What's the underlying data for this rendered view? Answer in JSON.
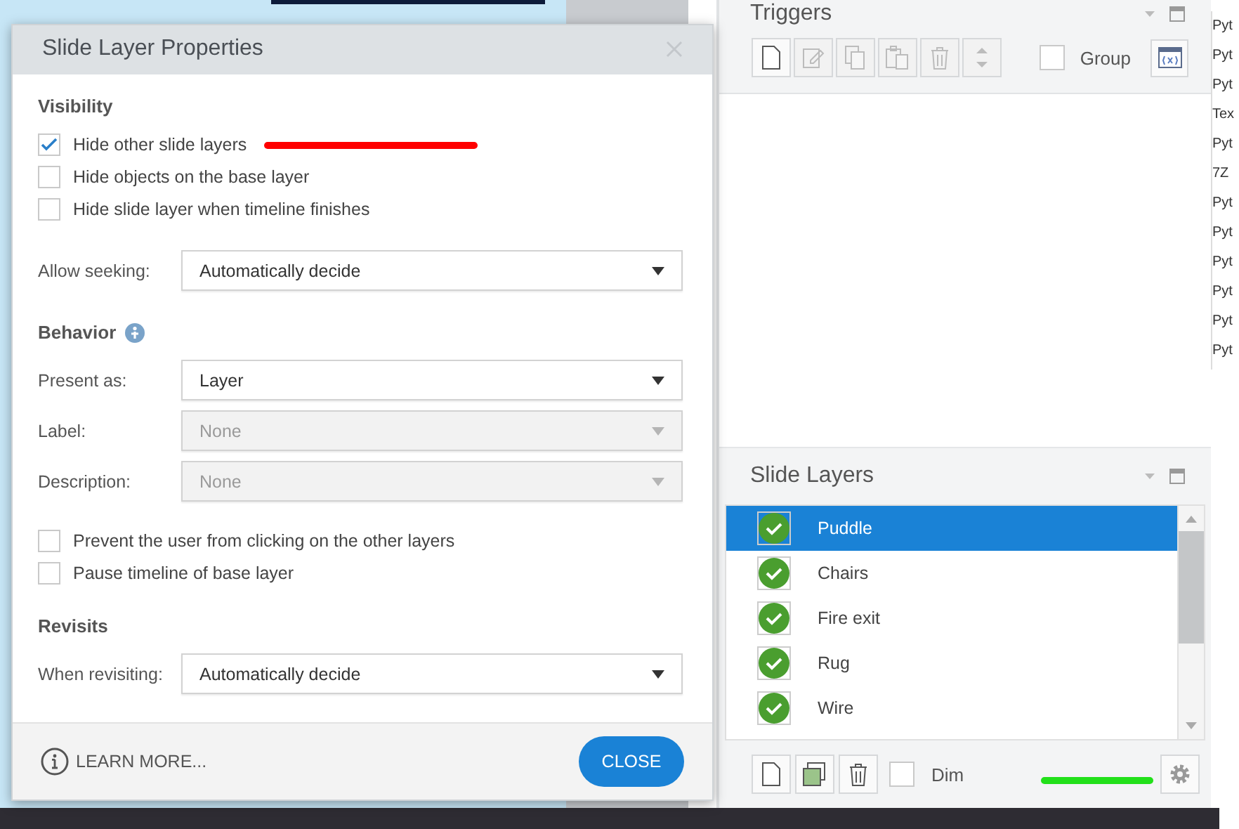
{
  "dialog": {
    "title": "Slide Layer Properties",
    "sections": [
      {
        "heading": "Visibility",
        "info_icon": false,
        "items": [
          {
            "kind": "checkbox",
            "label": "Hide other slide layers",
            "checked": true
          },
          {
            "kind": "checkbox",
            "label": "Hide objects on the base layer",
            "checked": false
          },
          {
            "kind": "checkbox",
            "label": "Hide slide layer when timeline finishes",
            "checked": false
          },
          {
            "kind": "dropdown",
            "label": "Allow seeking:",
            "value": "Automatically decide",
            "disabled": false
          }
        ]
      },
      {
        "heading": "Behavior",
        "info_icon": true,
        "items": [
          {
            "kind": "dropdown",
            "label": "Present as:",
            "value": "Layer",
            "disabled": false
          },
          {
            "kind": "dropdown",
            "label": "Label:",
            "value": "None",
            "disabled": true
          },
          {
            "kind": "dropdown",
            "label": "Description:",
            "value": "None",
            "disabled": true
          },
          {
            "kind": "checkbox",
            "label": "Prevent the user from clicking on the other layers",
            "checked": false
          },
          {
            "kind": "checkbox",
            "label": "Pause timeline of base layer",
            "checked": false
          }
        ]
      },
      {
        "heading": "Revisits",
        "info_icon": false,
        "items": [
          {
            "kind": "dropdown",
            "label": "When revisiting:",
            "value": "Automatically decide",
            "disabled": false
          }
        ]
      }
    ],
    "learn_more": "LEARN MORE...",
    "close_button": "CLOSE"
  },
  "triggers": {
    "title": "Triggers",
    "toolbar": [
      {
        "kind": "new",
        "disabled": false
      },
      {
        "kind": "edit",
        "disabled": true
      },
      {
        "kind": "copy",
        "disabled": true
      },
      {
        "kind": "paste",
        "disabled": true
      },
      {
        "kind": "delete",
        "disabled": true
      },
      {
        "kind": "updown",
        "disabled": true
      }
    ],
    "group": {
      "label": "Group",
      "checked": false
    }
  },
  "slide_layers": {
    "title": "Slide Layers",
    "items": [
      {
        "name": "Puddle",
        "selected": true,
        "visible": true
      },
      {
        "name": "Chairs",
        "selected": false,
        "visible": true
      },
      {
        "name": "Fire exit",
        "selected": false,
        "visible": true
      },
      {
        "name": "Rug",
        "selected": false,
        "visible": true
      },
      {
        "name": "Wire",
        "selected": false,
        "visible": true
      }
    ],
    "dim": {
      "label": "Dim",
      "checked": false
    }
  },
  "file_list": [
    "Pyt",
    "Pyt",
    "Pyt",
    "Tex",
    "Pyt",
    "7Z",
    "Pyt",
    "Pyt",
    "Pyt",
    "Pyt",
    "Pyt",
    "Pyt"
  ]
}
